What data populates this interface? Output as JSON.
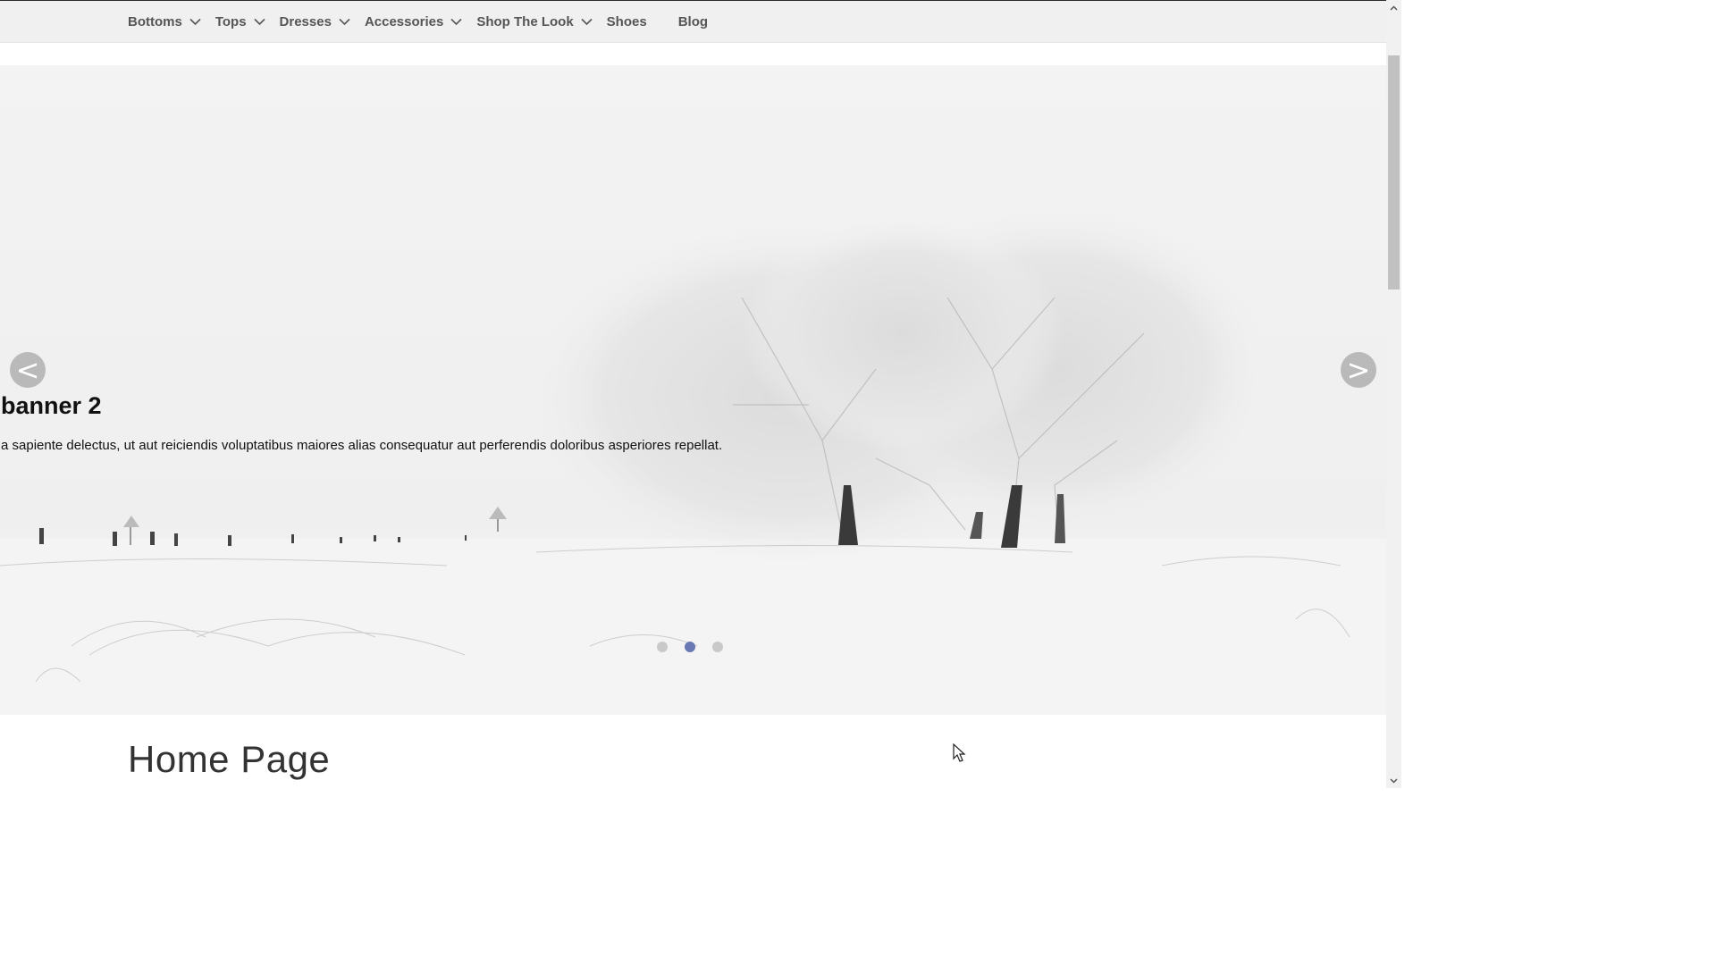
{
  "nav": {
    "items": [
      {
        "label": "Bottoms",
        "has_dropdown": true,
        "icon": "chevron-down-icon"
      },
      {
        "label": "Tops",
        "has_dropdown": true,
        "icon": "chevron-down-icon"
      },
      {
        "label": "Dresses",
        "has_dropdown": true,
        "icon": "chevron-down-icon"
      },
      {
        "label": "Accessories",
        "has_dropdown": true,
        "icon": "chevron-down-icon"
      },
      {
        "label": "Shop The Look",
        "has_dropdown": true,
        "icon": "chevron-down-icon"
      },
      {
        "label": "Shoes",
        "has_dropdown": false
      },
      {
        "label": "Blog",
        "has_dropdown": false
      }
    ]
  },
  "slider": {
    "prev_label": "<",
    "next_label": ">",
    "title": "banner 2",
    "text": "a sapiente delectus, ut aut reiciendis voluptatibus maiores alias consequatur aut perferendis doloribus asperiores repellat.",
    "image": "snowy-landscape-trees",
    "dot_count": 3,
    "active_dot": 2,
    "dot_active_color": "#6a78b5"
  },
  "main": {
    "page_title": "Home Page"
  }
}
